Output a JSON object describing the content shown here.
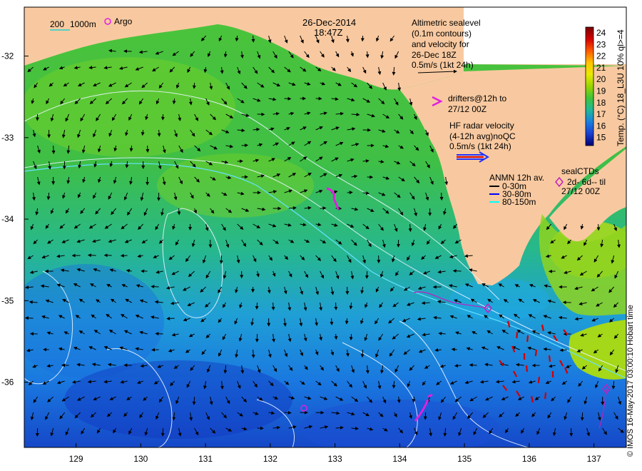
{
  "map": {
    "date": "26-Dec-2014",
    "time": "18:47Z",
    "scale_bar": "200",
    "depth_label": "1000m",
    "argo_label": "Argo",
    "lat_ticks": [
      "-32",
      "-33",
      "-34",
      "-35",
      "-36"
    ],
    "lon_ticks": [
      "129",
      "130",
      "131",
      "132",
      "133",
      "134",
      "135",
      "136",
      "137"
    ],
    "lat_range": [
      -36.8,
      -31.4
    ],
    "lon_range": [
      128.2,
      137.5
    ],
    "land_color": "#f8c9a0"
  },
  "legend": {
    "altimetric": [
      "Altimetric sealevel",
      "(0.1m contours)",
      "and velocity for",
      "26-Dec 18Z",
      "0.5m/s (1kt 24h)"
    ],
    "drifters": [
      "drifters@12h to",
      "27/12 00Z"
    ],
    "hf_radar": [
      "HF radar velocity",
      "(4-12h avg)noQC",
      "0.5m/s (1kt 24h)"
    ],
    "anmn": {
      "title": "ANMN 12h av.",
      "items": [
        {
          "label": "0-30m",
          "color": "#000000"
        },
        {
          "label": "30-80m",
          "color": "#0000ff"
        },
        {
          "label": "80-150m",
          "color": "#00ffff"
        }
      ]
    },
    "seal": [
      "sealCTDs",
      "2d- 6d-- til",
      "27/12 00Z"
    ]
  },
  "colorbar": {
    "labels": [
      "24",
      "23",
      "22",
      "21",
      "20",
      "19",
      "18",
      "17",
      "16",
      "15"
    ],
    "title": "Temp. (°C) 18_L3U 10% ql>=4",
    "colors": [
      "#7a0000",
      "#d40000",
      "#ff5a00",
      "#ffc400",
      "#e8ea00",
      "#9ad400",
      "#3ec43a",
      "#1fb89a",
      "#1a7fe0",
      "#1a3fd0",
      "#000070"
    ]
  },
  "credit": "© IMOS 16-May-2017 03:00:10 Hobart time"
}
